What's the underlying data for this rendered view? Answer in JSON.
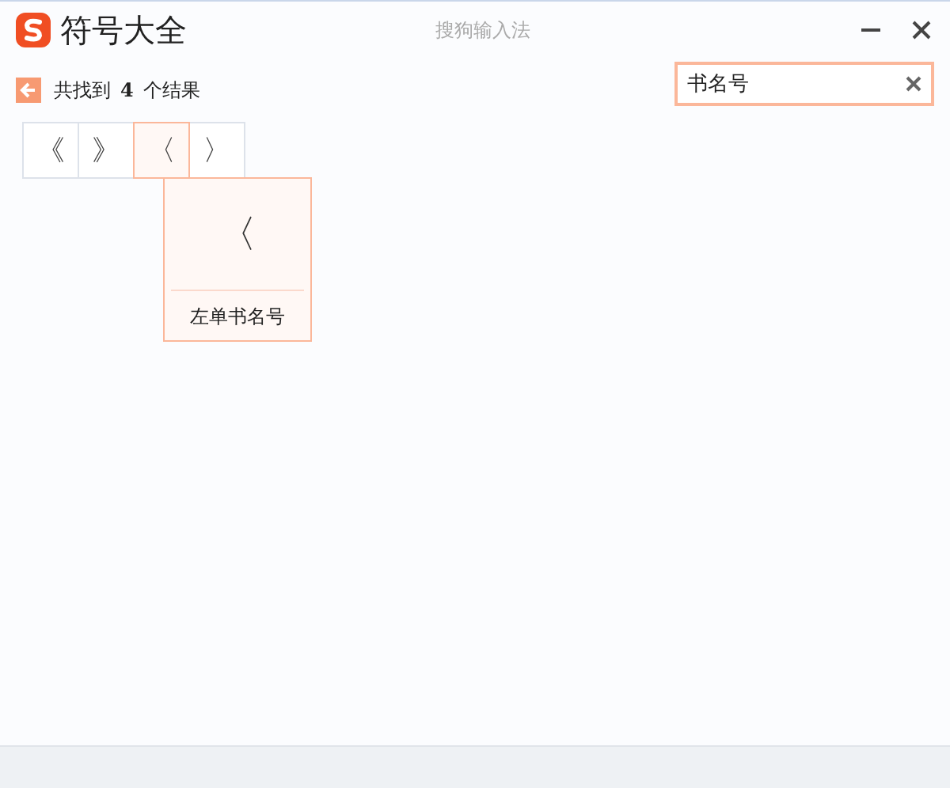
{
  "window": {
    "title": "符号大全",
    "app_name": "搜狗输入法"
  },
  "search": {
    "value": "书名号"
  },
  "results": {
    "prefix": "共找到",
    "count": "4",
    "suffix": "个结果"
  },
  "symbols": [
    {
      "char": "《",
      "selected": false
    },
    {
      "char": "》",
      "selected": false
    },
    {
      "char": "〈",
      "selected": true
    },
    {
      "char": "〉",
      "selected": false
    }
  ],
  "preview": {
    "char": "〈",
    "name": "左单书名号"
  }
}
